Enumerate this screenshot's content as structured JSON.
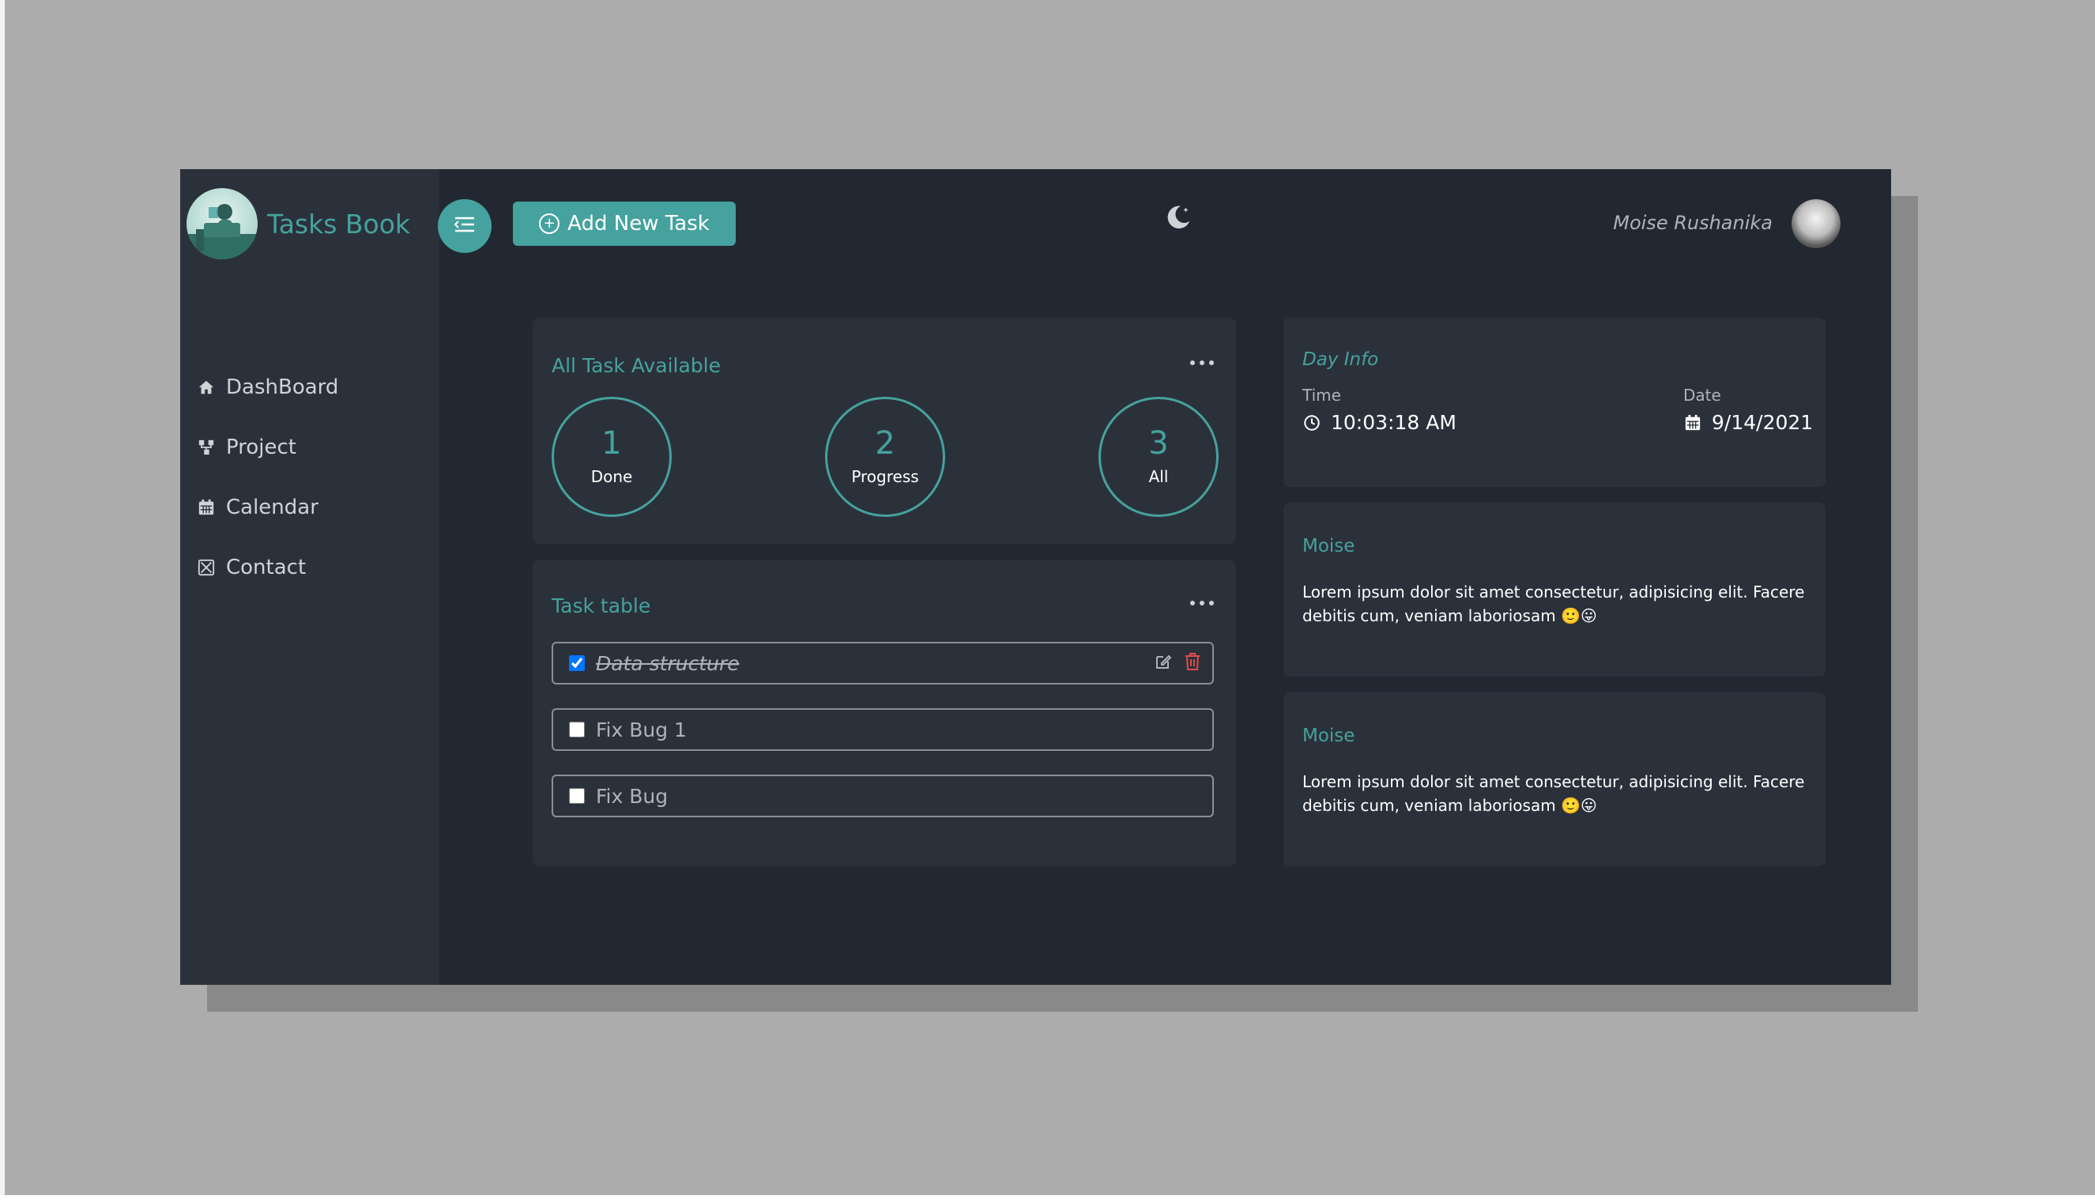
{
  "app": {
    "title": "Tasks Book",
    "add_button": "Add New Task",
    "user_name": "Moise Rushanika",
    "colors": {
      "accent": "#45a29e",
      "bg": "#222831",
      "card": "#2b313b"
    }
  },
  "sidebar": {
    "items": [
      {
        "label": "DashBoard",
        "icon": "home-icon"
      },
      {
        "label": "Project",
        "icon": "project-icon"
      },
      {
        "label": "Calendar",
        "icon": "calendar-icon"
      },
      {
        "label": "Contact",
        "icon": "contact-icon"
      }
    ]
  },
  "summary": {
    "title": "All Task Available",
    "stats": [
      {
        "value": "1",
        "label": "Done"
      },
      {
        "value": "2",
        "label": "Progress"
      },
      {
        "value": "3",
        "label": "All"
      }
    ]
  },
  "tasks": {
    "title": "Task table",
    "items": [
      {
        "label": "Data structure",
        "checked": true
      },
      {
        "label": "Fix Bug 1",
        "checked": false
      },
      {
        "label": "Fix Bug",
        "checked": false
      }
    ]
  },
  "day_info": {
    "title": "Day Info",
    "time_label": "Time",
    "time_value": "10:03:18 AM",
    "date_label": "Date",
    "date_value": "9/14/2021"
  },
  "notes": [
    {
      "title": "Moise",
      "text": "Lorem ipsum dolor sit amet consectetur, adipisicing elit. Facere debitis cum, veniam laboriosam 🙂😛"
    },
    {
      "title": "Moise",
      "text": "Lorem ipsum dolor sit amet consectetur, adipisicing elit. Facere debitis cum, veniam laboriosam 🙂😛"
    }
  ]
}
